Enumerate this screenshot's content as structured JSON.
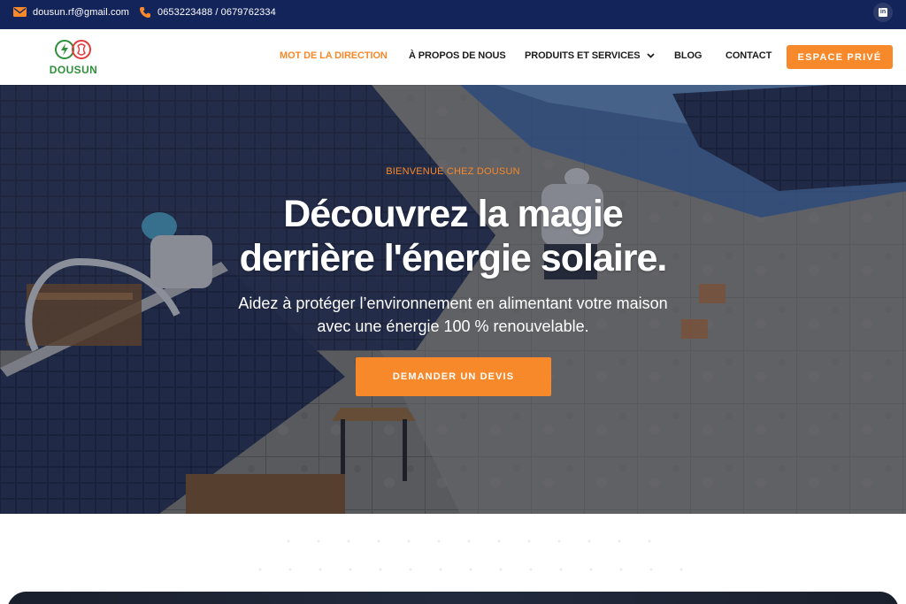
{
  "topbar": {
    "email": "dousun.rf@gmail.com",
    "phone": "0653223488 / 0679762334",
    "email_icon": "mail-icon",
    "phone_icon": "phone-icon",
    "social_icon": "linkedin-icon"
  },
  "header": {
    "brand": "DOUSUN",
    "nav": [
      {
        "label": "MOT DE LA DIRECTION",
        "active": true
      },
      {
        "label": "À PROPOS DE NOUS"
      },
      {
        "label": "PRODUITS ET SERVICES",
        "has_dropdown": true
      },
      {
        "label": "BLOG"
      },
      {
        "label": "CONTACT"
      }
    ],
    "cta": "ESPACE PRIVÉ"
  },
  "hero": {
    "eyebrow": "BIENVENUE CHEZ DOUSUN",
    "title_line1": "Découvrez la magie",
    "title_line2": "derrière l'énergie solaire.",
    "subtitle_line1": "Aidez à protéger l’environnement en alimentant votre maison",
    "subtitle_line2": "avec une énergie 100 % renouvelable.",
    "cta": "DEMANDER UN DEVIS"
  },
  "colors": {
    "topbar_bg": "#13245a",
    "accent": "#f7892a",
    "brand_green": "#2f8f3a",
    "brand_red": "#e23b3b"
  }
}
